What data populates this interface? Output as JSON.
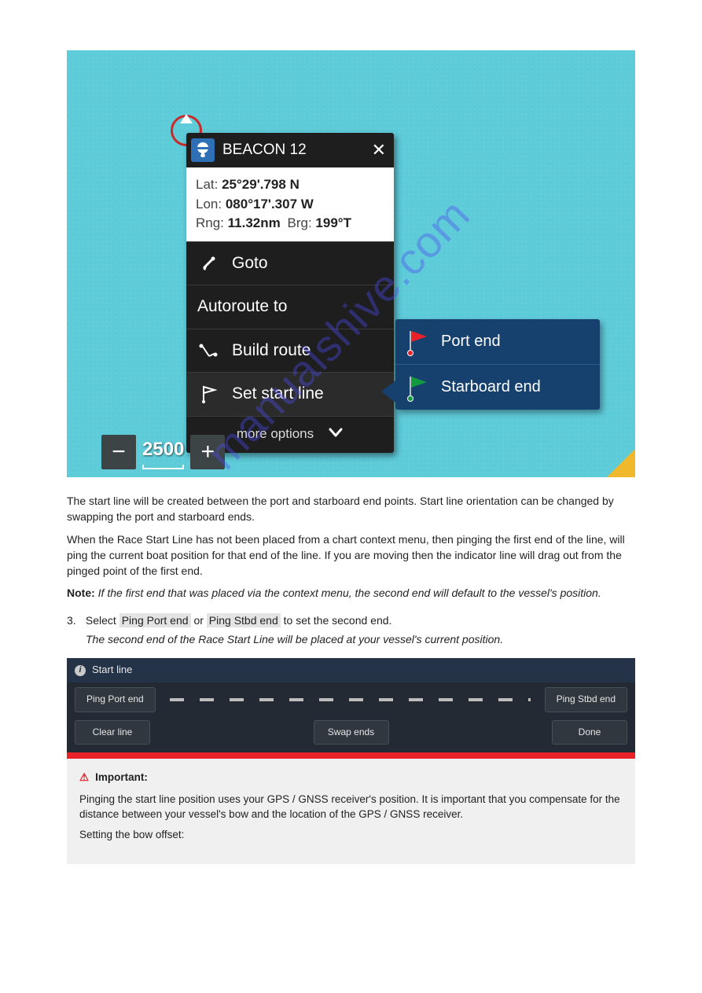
{
  "popup": {
    "title": "BEACON 12",
    "lat_label": "Lat:",
    "lat_val": "25°29'.798 N",
    "lon_label": "Lon:",
    "lon_val": "080°17'.307 W",
    "rng_label": "Rng:",
    "rng_val": "11.32nm",
    "brg_label": "Brg:",
    "brg_val": "199°T",
    "goto": "Goto",
    "autoroute": "Autoroute to",
    "build_route": "Build route",
    "start_line": "Set start line",
    "more": "more options"
  },
  "submenu": {
    "port": "Port end",
    "stbd": "Starboard end"
  },
  "scale": "2500",
  "body": {
    "p1": "The start line will be created between the port and starboard end points. Start line orientation can be changed by swapping the port and starboard ends.",
    "p2": "When the Race Start Line has not been placed from a chart context menu, then pinging the first end of the line, will ping the current boat position for that end of the line. If you are moving then the indicator line will drag out from the pinged point of the first end.",
    "note_lbl": "Note:",
    "note": "If the first end that was placed via the context menu, the second end will default to the vessel's position.",
    "step1_pre": "Select",
    "step1_btn": "Ping Port end",
    "step1_or": "or",
    "step1_btn2": "Ping Stbd end",
    "step1_post": "to set the second end.",
    "sub": "The second end of the Race Start Line will be placed at your vessel's current position."
  },
  "toolbar": {
    "title": "Start line",
    "ping_port": "Ping Port end",
    "ping_stbd": "Ping Stbd end",
    "clear": "Clear line",
    "swap": "Swap ends",
    "done": "Done"
  },
  "footer": {
    "warn": "⚠",
    "imp": "Important:",
    "l1": "Pinging the start line position uses your GPS / GNSS receiver's position. It is important that you compensate for the distance between your vessel's bow and the location of the GPS / GNSS receiver.",
    "l2": "Setting the bow offset:"
  },
  "watermark": "manualshive.com"
}
